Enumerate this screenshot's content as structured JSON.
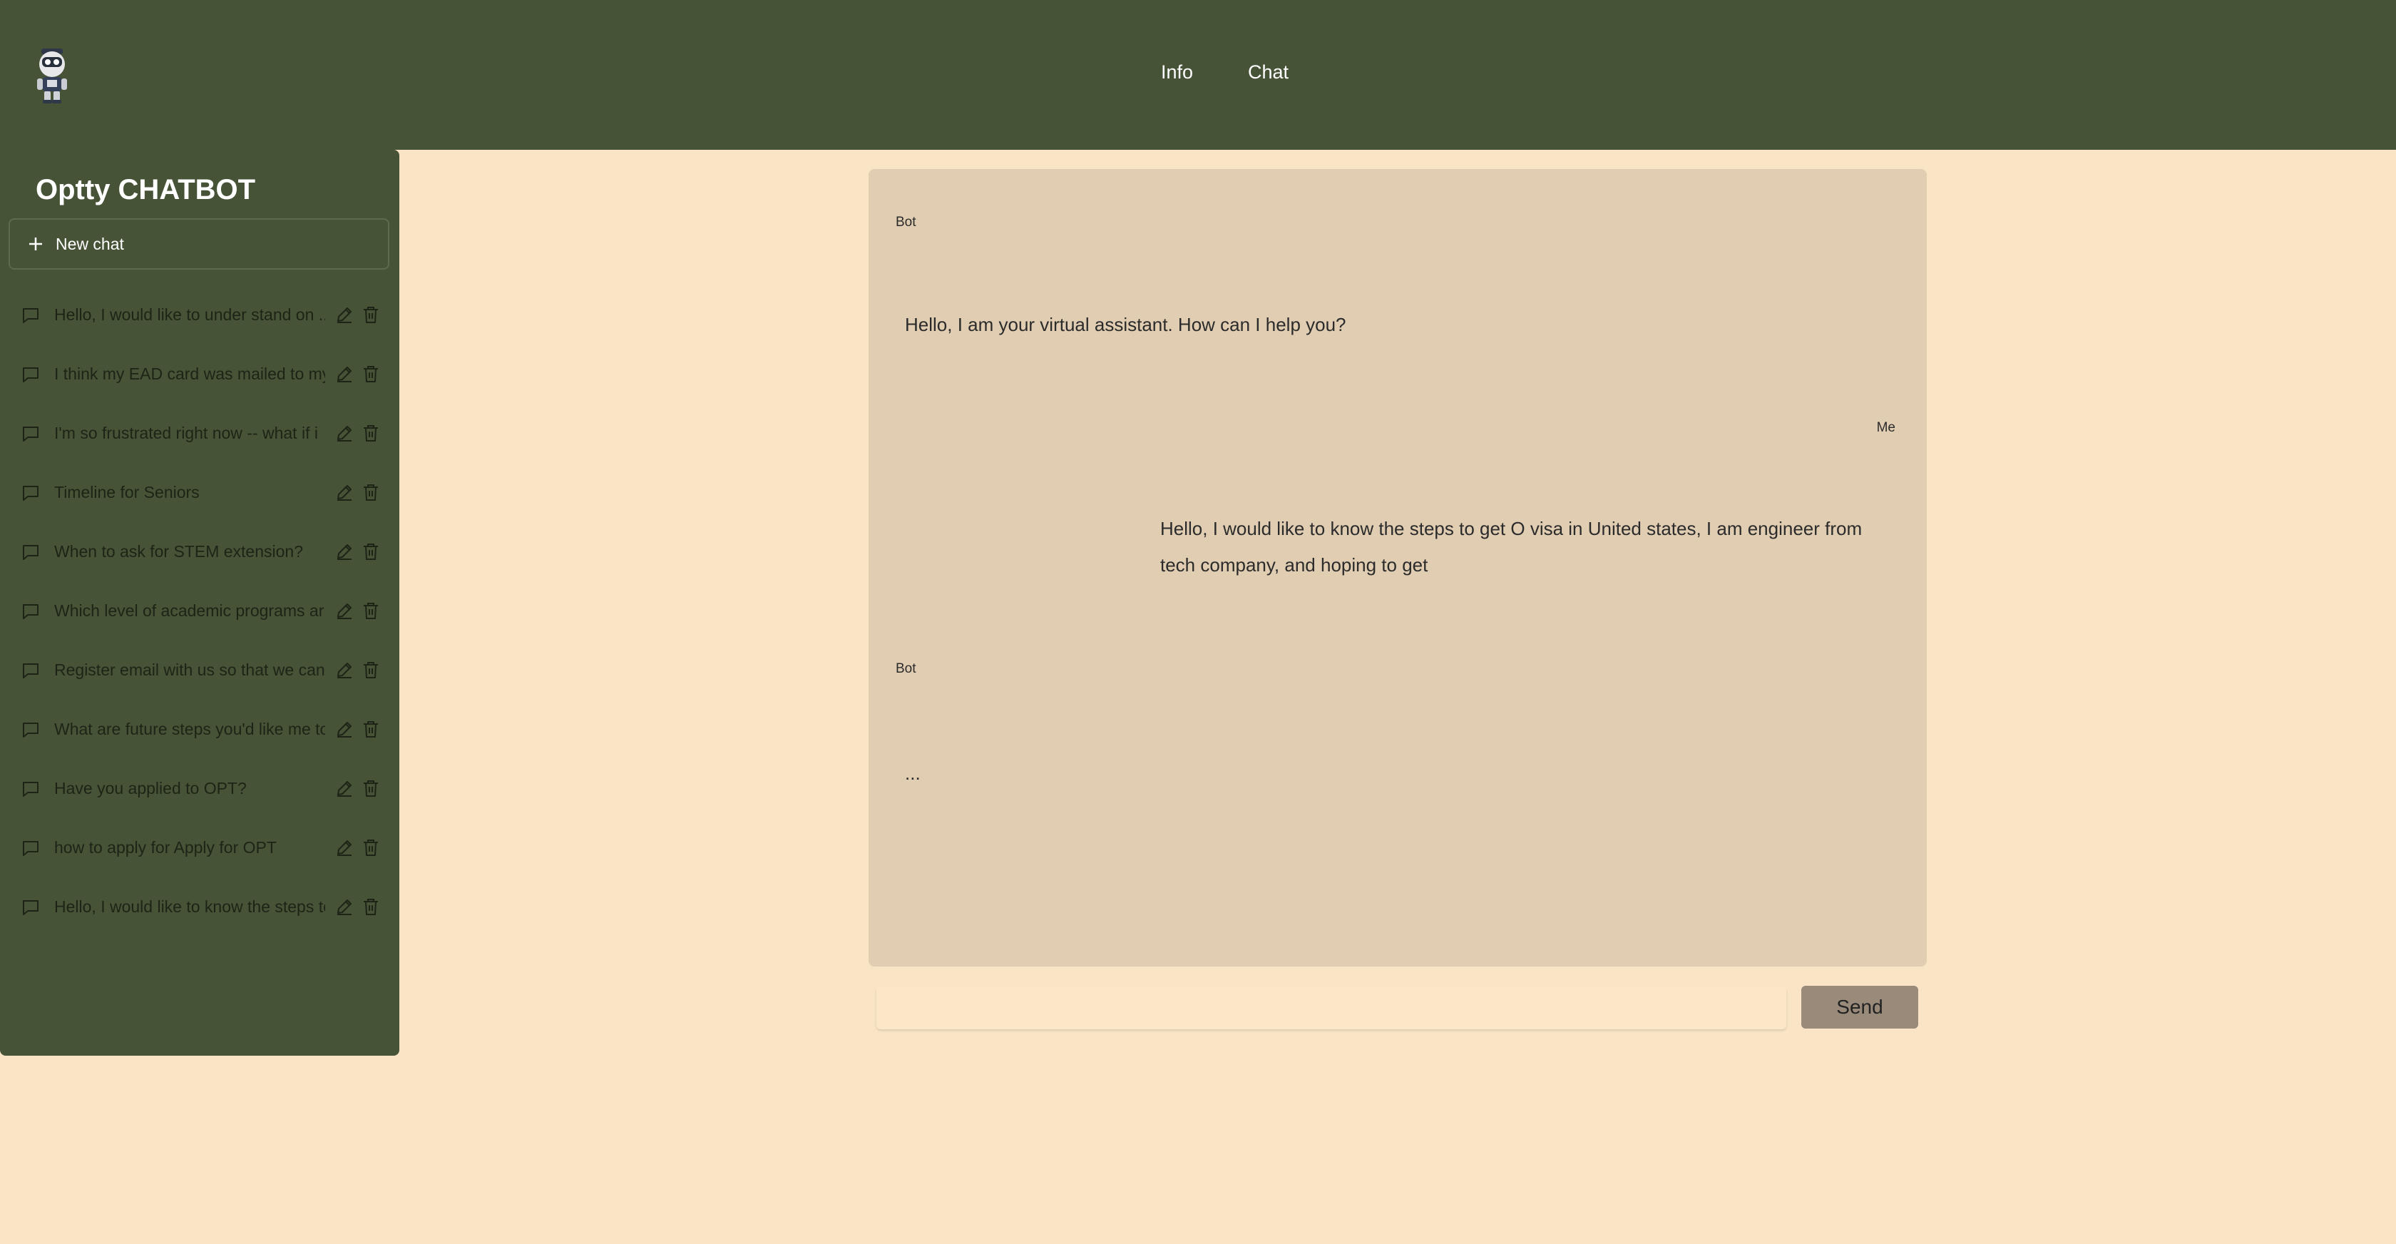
{
  "app": {
    "logo_icon": "robot-mascot-icon",
    "nav": {
      "info": "Info",
      "chat": "Chat"
    }
  },
  "sidebar": {
    "title": "Optty CHATBOT",
    "new_chat_label": "New chat",
    "history": [
      {
        "text": "Hello, I would like to under stand on ...",
        "icon": "message-icon"
      },
      {
        "text": "I think my EAD card was mailed to my",
        "icon": "message-icon"
      },
      {
        "text": "I'm so frustrated right now -- what if i",
        "icon": "message-icon"
      },
      {
        "text": "Timeline for Seniors",
        "icon": "message-icon"
      },
      {
        "text": "When to ask for STEM extension?",
        "icon": "message-icon"
      },
      {
        "text": "Which level of academic programs ar",
        "icon": "message-icon"
      },
      {
        "text": "Register email with us so that we can",
        "icon": "message-icon"
      },
      {
        "text": "What are future steps you'd like me to",
        "icon": "message-icon"
      },
      {
        "text": "Have you applied to OPT?",
        "icon": "message-icon"
      },
      {
        "text": "how to apply for Apply for OPT",
        "icon": "message-icon"
      },
      {
        "text": "Hello, I would like to know the steps to",
        "icon": "message-icon"
      }
    ]
  },
  "chat": {
    "messages": [
      {
        "sender": "Bot",
        "text": "Hello, I am your virtual assistant. How can I help you?"
      },
      {
        "sender": "Me",
        "text": "Hello, I would like to know the steps to get O visa in United states, I am engineer from tech company, and hoping to get"
      },
      {
        "sender": "Bot",
        "text": "..."
      }
    ],
    "input_value": "",
    "send_label": "Send"
  },
  "colors": {
    "header_bg": "#465337",
    "page_bg": "#fae4c6",
    "chat_panel_bg": "#e1cdb2",
    "send_button_bg": "#998a7a"
  }
}
